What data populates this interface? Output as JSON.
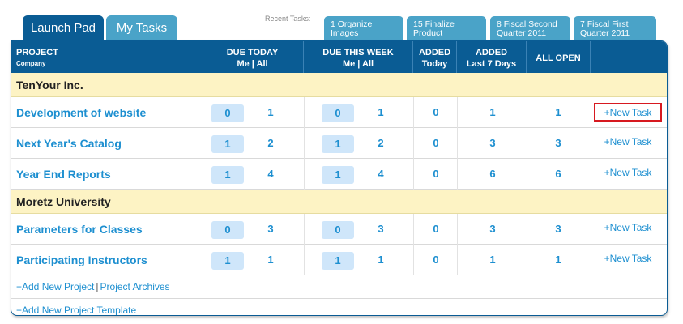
{
  "tabs": {
    "launch_pad": "Launch Pad",
    "my_tasks": "My Tasks"
  },
  "recent": {
    "label": "Recent Tasks:",
    "items": [
      {
        "line1": "1 Organize",
        "line2": "Images"
      },
      {
        "line1": "15 Finalize",
        "line2": "Product"
      },
      {
        "line1": "8 Fiscal Second",
        "line2": "Quarter 2011"
      },
      {
        "line1": "7 Fiscal First",
        "line2": "Quarter 2011"
      }
    ]
  },
  "header": {
    "project": "PROJECT",
    "company": "Company",
    "due_today": "DUE TODAY",
    "due_today_sub": "Me | All",
    "due_week": "DUE THIS WEEK",
    "due_week_sub": "Me | All",
    "added_today": "ADDED",
    "added_today_sub": "Today",
    "added_7": "ADDED",
    "added_7_sub": "Last 7 Days",
    "all_open": "ALL OPEN"
  },
  "groups": [
    {
      "company": "TenYour Inc.",
      "projects": [
        {
          "name": "Development of website",
          "today_me": "0",
          "today_all": "1",
          "week_me": "0",
          "week_all": "1",
          "added_today": "0",
          "added_7": "1",
          "all_open": "1",
          "new_task": "+New Task"
        },
        {
          "name": "Next Year's Catalog",
          "today_me": "1",
          "today_all": "2",
          "week_me": "1",
          "week_all": "2",
          "added_today": "0",
          "added_7": "3",
          "all_open": "3",
          "new_task": "+New Task"
        },
        {
          "name": "Year End Reports",
          "today_me": "1",
          "today_all": "4",
          "week_me": "1",
          "week_all": "4",
          "added_today": "0",
          "added_7": "6",
          "all_open": "6",
          "new_task": "+New Task"
        }
      ]
    },
    {
      "company": "Moretz University",
      "projects": [
        {
          "name": "Parameters for Classes",
          "today_me": "0",
          "today_all": "3",
          "week_me": "0",
          "week_all": "3",
          "added_today": "0",
          "added_7": "3",
          "all_open": "3",
          "new_task": "+New Task"
        },
        {
          "name": "Participating Instructors",
          "today_me": "1",
          "today_all": "1",
          "week_me": "1",
          "week_all": "1",
          "added_today": "0",
          "added_7": "1",
          "all_open": "1",
          "new_task": "+New Task"
        }
      ]
    }
  ],
  "footer": {
    "add_project": "+Add New Project",
    "separator": "|",
    "archives": "Project Archives",
    "add_template": "+Add New Project Template"
  },
  "colors": {
    "header_bg": "#0a5c94",
    "tab_inactive": "#4aa3c8",
    "link": "#1d8fd0",
    "group_bg": "#fdf3c4",
    "count_box": "#cfe6fa",
    "highlight": "#d71920"
  }
}
